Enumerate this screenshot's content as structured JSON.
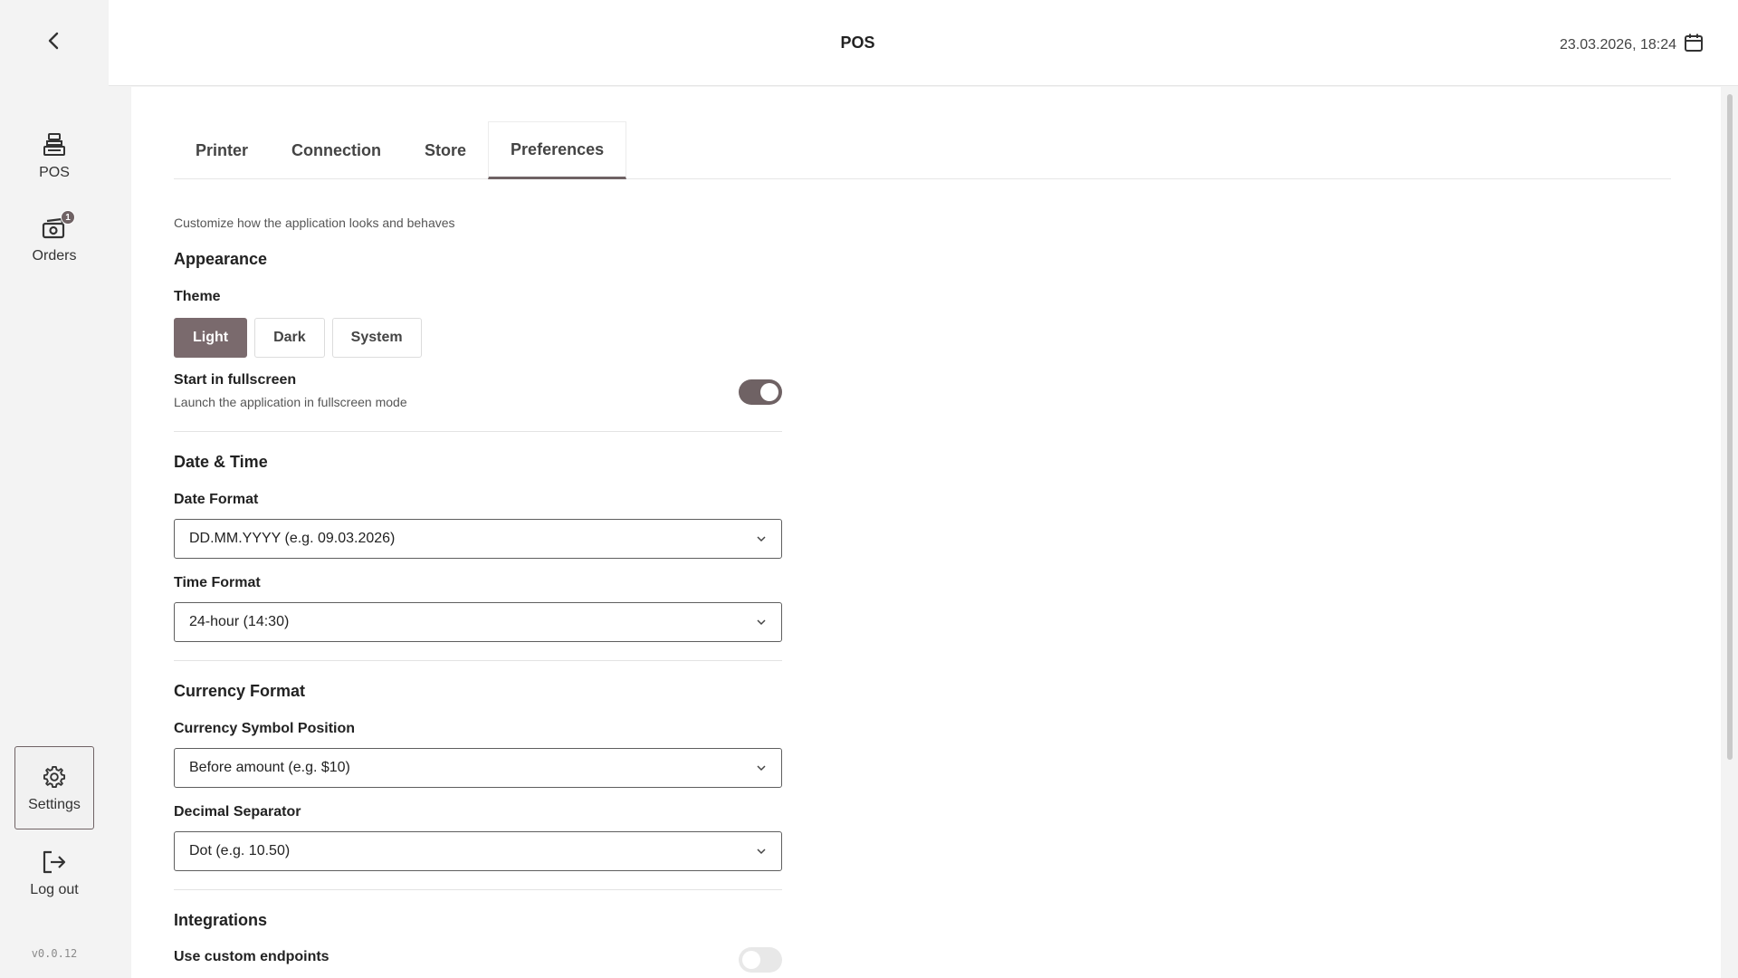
{
  "header": {
    "title": "POS",
    "datetime": "23.03.2026, 18:24"
  },
  "sidebar": {
    "items": [
      {
        "label": "POS",
        "icon": "register-icon"
      },
      {
        "label": "Orders",
        "icon": "orders-icon",
        "badge": "1"
      },
      {
        "label": "Settings",
        "icon": "gear-icon",
        "active": true
      },
      {
        "label": "Log out",
        "icon": "logout-icon"
      }
    ],
    "version": "v0.0.12"
  },
  "tabs": [
    {
      "label": "Printer"
    },
    {
      "label": "Connection"
    },
    {
      "label": "Store"
    },
    {
      "label": "Preferences",
      "active": true
    }
  ],
  "preferences": {
    "subtitle": "Customize how the application looks and behaves",
    "appearance": {
      "title": "Appearance",
      "theme_label": "Theme",
      "theme_options": [
        "Light",
        "Dark",
        "System"
      ],
      "theme_selected": "Light",
      "fullscreen_label": "Start in fullscreen",
      "fullscreen_help": "Launch the application in fullscreen mode",
      "fullscreen_on": true
    },
    "datetime": {
      "title": "Date & Time",
      "date_format_label": "Date Format",
      "date_format_value": "DD.MM.YYYY (e.g. 09.03.2026)",
      "time_format_label": "Time Format",
      "time_format_value": "24-hour (14:30)"
    },
    "currency": {
      "title": "Currency Format",
      "symbol_position_label": "Currency Symbol Position",
      "symbol_position_value": "Before amount (e.g. $10)",
      "decimal_separator_label": "Decimal Separator",
      "decimal_separator_value": "Dot (e.g. 10.50)"
    },
    "integrations": {
      "title": "Integrations",
      "custom_endpoints_label": "Use custom endpoints",
      "custom_endpoints_on": false
    }
  },
  "colors": {
    "accent": "#6f6264",
    "theme_active": "#7a6a6d",
    "background": "#f3f3f3"
  }
}
